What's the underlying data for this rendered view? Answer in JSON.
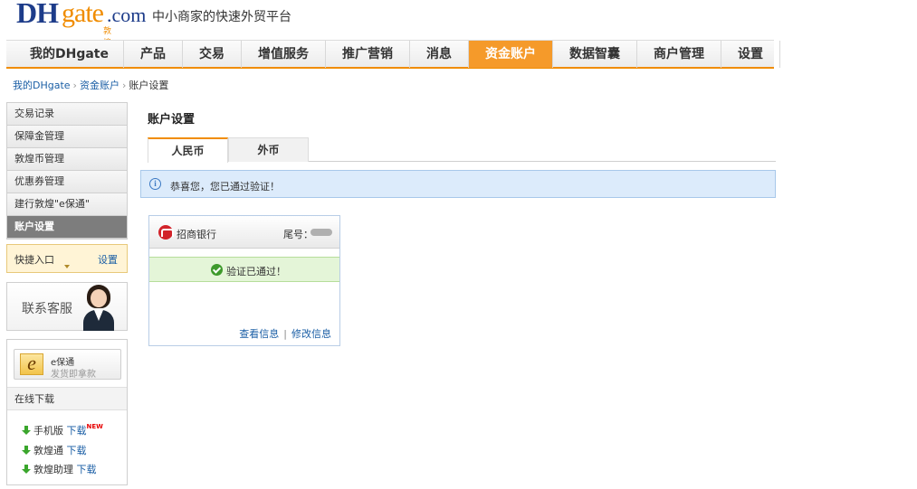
{
  "header": {
    "logo_dh": "DH",
    "logo_gate": "gate",
    "logo_com": ".com",
    "logo_sub": "敦煌网",
    "tagline": "中小商家的快速外贸平台"
  },
  "nav": {
    "items": [
      "我的DHgate",
      "产品",
      "交易",
      "增值服务",
      "推广营销",
      "消息",
      "资金账户",
      "数据智囊",
      "商户管理",
      "设置"
    ],
    "active": "资金账户"
  },
  "breadcrumb": {
    "items": [
      "我的DHgate",
      "资金账户",
      "账户设置"
    ],
    "separator": "›"
  },
  "sidebar": {
    "menu": [
      "交易记录",
      "保障金管理",
      "敦煌币管理",
      "优惠券管理",
      "建行敦煌\"e保通\"",
      "账户设置"
    ],
    "active": "账户设置",
    "quick_entry": "快捷入口",
    "quick_setting": "设置",
    "customer_service": "联系客服",
    "ebao_title": "e保通",
    "ebao_sub": "发货即拿款",
    "ebao_letter": "e",
    "download_title": "在线下载",
    "downloads": [
      {
        "name": "手机版",
        "link": "下载",
        "badge": "NEW"
      },
      {
        "name": "敦煌通",
        "link": "下载"
      },
      {
        "name": "敦煌助理",
        "link": "下载"
      }
    ]
  },
  "main": {
    "title": "账户设置",
    "tabs": [
      "人民币",
      "外币"
    ],
    "active_tab": "人民币",
    "notice": "恭喜您，您已通过验证！",
    "notice_icon": "i",
    "card": {
      "bank": "招商银行",
      "tail_label": "尾号：",
      "status": "验证已通过！",
      "link_view": "查看信息",
      "link_sep": "|",
      "link_edit": "修改信息"
    }
  },
  "colors": {
    "accent": "#f08c00",
    "link": "#1a5ea5",
    "notice_bg": "#dcebfb",
    "success_bg": "#e4f5d8"
  }
}
